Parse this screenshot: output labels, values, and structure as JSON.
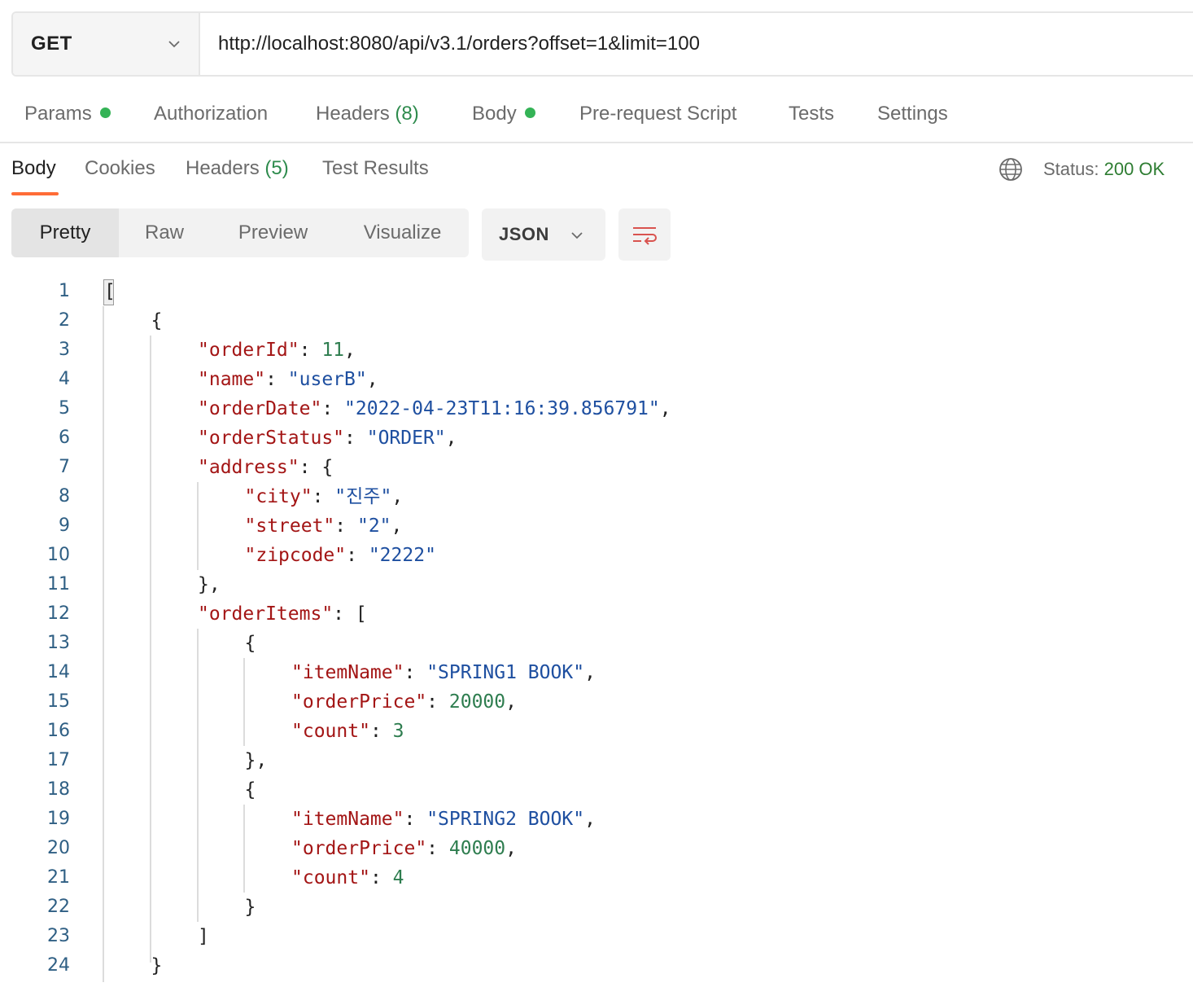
{
  "request": {
    "method": "GET",
    "url": "http://localhost:8080/api/v3.1/orders?offset=1&limit=100"
  },
  "request_tabs": {
    "params": "Params",
    "authorization": "Authorization",
    "headers": "Headers",
    "headers_count": "(8)",
    "body": "Body",
    "pre_request_script": "Pre-request Script",
    "tests": "Tests",
    "settings": "Settings"
  },
  "response_tabs": {
    "body": "Body",
    "cookies": "Cookies",
    "headers": "Headers",
    "headers_count": "(5)",
    "test_results": "Test Results"
  },
  "status": {
    "label": "Status:",
    "value": "200 OK"
  },
  "view_modes": {
    "pretty": "Pretty",
    "raw": "Raw",
    "preview": "Preview",
    "visualize": "Visualize"
  },
  "format": "JSON",
  "colors": {
    "accent": "#ff6c37",
    "status_ok": "#2e7d32",
    "dot": "#34b356",
    "json_key": "#a31515",
    "json_string": "#1e4fa0",
    "json_number": "#2e7d4f"
  },
  "icons": {
    "method_dropdown": "chevron-down-icon",
    "format_dropdown": "chevron-down-icon",
    "network": "globe-icon",
    "wrap": "wrap-lines-icon"
  },
  "code_lines": [
    {
      "n": "1",
      "tokens": [
        {
          "t": "[",
          "c": "p"
        }
      ]
    },
    {
      "n": "2",
      "tokens": [
        {
          "t": "{",
          "c": "p"
        }
      ]
    },
    {
      "n": "3",
      "tokens": [
        {
          "t": "\"orderId\"",
          "c": "k"
        },
        {
          "t": ": ",
          "c": "p"
        },
        {
          "t": "11",
          "c": "n"
        },
        {
          "t": ",",
          "c": "p"
        }
      ]
    },
    {
      "n": "4",
      "tokens": [
        {
          "t": "\"name\"",
          "c": "k"
        },
        {
          "t": ": ",
          "c": "p"
        },
        {
          "t": "\"userB\"",
          "c": "s"
        },
        {
          "t": ",",
          "c": "p"
        }
      ]
    },
    {
      "n": "5",
      "tokens": [
        {
          "t": "\"orderDate\"",
          "c": "k"
        },
        {
          "t": ": ",
          "c": "p"
        },
        {
          "t": "\"2022-04-23T11:16:39.856791\"",
          "c": "s"
        },
        {
          "t": ",",
          "c": "p"
        }
      ]
    },
    {
      "n": "6",
      "tokens": [
        {
          "t": "\"orderStatus\"",
          "c": "k"
        },
        {
          "t": ": ",
          "c": "p"
        },
        {
          "t": "\"ORDER\"",
          "c": "s"
        },
        {
          "t": ",",
          "c": "p"
        }
      ]
    },
    {
      "n": "7",
      "tokens": [
        {
          "t": "\"address\"",
          "c": "k"
        },
        {
          "t": ": {",
          "c": "p"
        }
      ]
    },
    {
      "n": "8",
      "tokens": [
        {
          "t": "\"city\"",
          "c": "k"
        },
        {
          "t": ": ",
          "c": "p"
        },
        {
          "t": "\"진주\"",
          "c": "s"
        },
        {
          "t": ",",
          "c": "p"
        }
      ]
    },
    {
      "n": "9",
      "tokens": [
        {
          "t": "\"street\"",
          "c": "k"
        },
        {
          "t": ": ",
          "c": "p"
        },
        {
          "t": "\"2\"",
          "c": "s"
        },
        {
          "t": ",",
          "c": "p"
        }
      ]
    },
    {
      "n": "10",
      "tokens": [
        {
          "t": "\"zipcode\"",
          "c": "k"
        },
        {
          "t": ": ",
          "c": "p"
        },
        {
          "t": "\"2222\"",
          "c": "s"
        }
      ]
    },
    {
      "n": "11",
      "tokens": [
        {
          "t": "},",
          "c": "p"
        }
      ]
    },
    {
      "n": "12",
      "tokens": [
        {
          "t": "\"orderItems\"",
          "c": "k"
        },
        {
          "t": ": [",
          "c": "p"
        }
      ]
    },
    {
      "n": "13",
      "tokens": [
        {
          "t": "{",
          "c": "p"
        }
      ]
    },
    {
      "n": "14",
      "tokens": [
        {
          "t": "\"itemName\"",
          "c": "k"
        },
        {
          "t": ": ",
          "c": "p"
        },
        {
          "t": "\"SPRING1 BOOK\"",
          "c": "s"
        },
        {
          "t": ",",
          "c": "p"
        }
      ]
    },
    {
      "n": "15",
      "tokens": [
        {
          "t": "\"orderPrice\"",
          "c": "k"
        },
        {
          "t": ": ",
          "c": "p"
        },
        {
          "t": "20000",
          "c": "n"
        },
        {
          "t": ",",
          "c": "p"
        }
      ]
    },
    {
      "n": "16",
      "tokens": [
        {
          "t": "\"count\"",
          "c": "k"
        },
        {
          "t": ": ",
          "c": "p"
        },
        {
          "t": "3",
          "c": "n"
        }
      ]
    },
    {
      "n": "17",
      "tokens": [
        {
          "t": "},",
          "c": "p"
        }
      ]
    },
    {
      "n": "18",
      "tokens": [
        {
          "t": "{",
          "c": "p"
        }
      ]
    },
    {
      "n": "19",
      "tokens": [
        {
          "t": "\"itemName\"",
          "c": "k"
        },
        {
          "t": ": ",
          "c": "p"
        },
        {
          "t": "\"SPRING2 BOOK\"",
          "c": "s"
        },
        {
          "t": ",",
          "c": "p"
        }
      ]
    },
    {
      "n": "20",
      "tokens": [
        {
          "t": "\"orderPrice\"",
          "c": "k"
        },
        {
          "t": ": ",
          "c": "p"
        },
        {
          "t": "40000",
          "c": "n"
        },
        {
          "t": ",",
          "c": "p"
        }
      ]
    },
    {
      "n": "21",
      "tokens": [
        {
          "t": "\"count\"",
          "c": "k"
        },
        {
          "t": ": ",
          "c": "p"
        },
        {
          "t": "4",
          "c": "n"
        }
      ]
    },
    {
      "n": "22",
      "tokens": [
        {
          "t": "}",
          "c": "p"
        }
      ]
    },
    {
      "n": "23",
      "tokens": [
        {
          "t": "]",
          "c": "p"
        }
      ]
    },
    {
      "n": "24",
      "tokens": [
        {
          "t": "}",
          "c": "p"
        }
      ]
    }
  ]
}
